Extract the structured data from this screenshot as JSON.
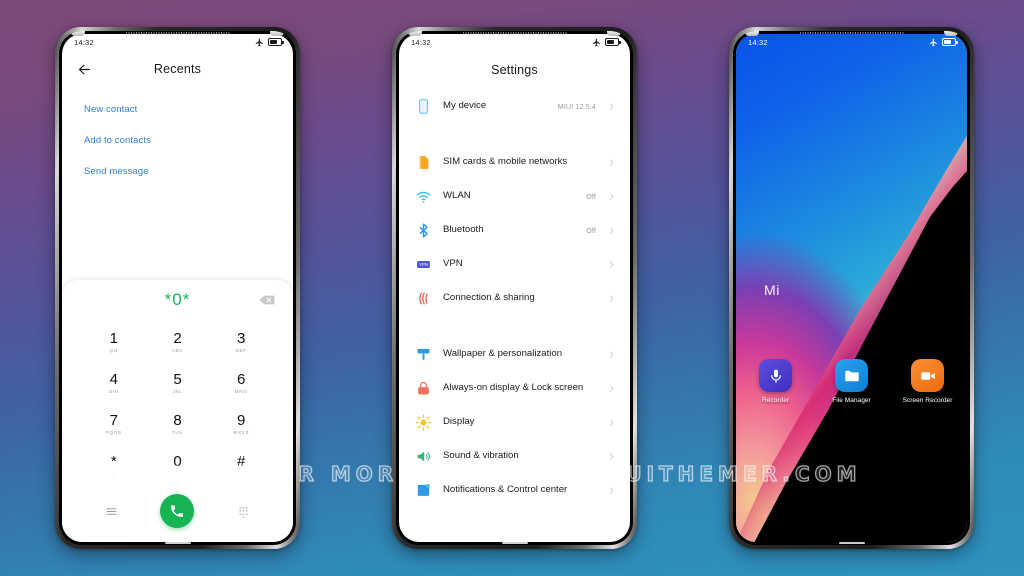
{
  "watermark": "VISIT FOR MORE THEMES - MIUITHEMER.COM",
  "status_bar": {
    "time": "14:32",
    "airplane_icon": "airplane-mode-icon",
    "battery_icon": "battery-icon"
  },
  "phone1": {
    "name": "dialer-phone",
    "header": {
      "back_icon": "back-arrow-icon",
      "title": "Recents"
    },
    "links": [
      {
        "label": "New contact"
      },
      {
        "label": "Add to contacts"
      },
      {
        "label": "Send message"
      }
    ],
    "dialer": {
      "number": "*0*",
      "backspace_icon": "backspace-icon",
      "keys": [
        {
          "digit": "1",
          "sub": "QD"
        },
        {
          "digit": "2",
          "sub": "ABC"
        },
        {
          "digit": "3",
          "sub": "DEF"
        },
        {
          "digit": "4",
          "sub": "GHI"
        },
        {
          "digit": "5",
          "sub": "JKL"
        },
        {
          "digit": "6",
          "sub": "MNO"
        },
        {
          "digit": "7",
          "sub": "PQRS"
        },
        {
          "digit": "8",
          "sub": "TUV"
        },
        {
          "digit": "9",
          "sub": "WXYZ"
        },
        {
          "digit": "*",
          "sub": ","
        },
        {
          "digit": "0",
          "sub": ""
        },
        {
          "digit": "#",
          "sub": ""
        }
      ],
      "menu_icon": "menu-icon",
      "call_icon": "call-icon",
      "keypad_icon": "keypad-grid-icon",
      "call_color": "#18b454",
      "number_color": "#19b558"
    }
  },
  "phone2": {
    "name": "settings-phone",
    "title": "Settings",
    "groups": [
      {
        "rows": [
          {
            "icon": "device-icon",
            "label": "My device",
            "value": "MIUI 12.5.4",
            "chevron": "chevron-right-icon"
          }
        ]
      },
      {
        "rows": [
          {
            "icon": "sim-card-icon",
            "label": "SIM cards & mobile networks",
            "value": "",
            "chevron": "chevron-right-icon"
          },
          {
            "icon": "wifi-icon",
            "label": "WLAN",
            "value": "Off",
            "chevron": "chevron-right-icon"
          },
          {
            "icon": "bluetooth-icon",
            "label": "Bluetooth",
            "value": "Off",
            "chevron": "chevron-right-icon"
          },
          {
            "icon": "vpn-icon",
            "label": "VPN",
            "value": "",
            "chevron": "chevron-right-icon"
          },
          {
            "icon": "connection-sharing-icon",
            "label": "Connection & sharing",
            "value": "",
            "chevron": "chevron-right-icon"
          }
        ]
      },
      {
        "rows": [
          {
            "icon": "wallpaper-icon",
            "label": "Wallpaper & personalization",
            "value": "",
            "chevron": "chevron-right-icon"
          },
          {
            "icon": "lock-screen-icon",
            "label": "Always-on display & Lock screen",
            "value": "",
            "chevron": "chevron-right-icon"
          },
          {
            "icon": "display-icon",
            "label": "Display",
            "value": "",
            "chevron": "chevron-right-icon"
          },
          {
            "icon": "sound-icon",
            "label": "Sound & vibration",
            "value": "",
            "chevron": "chevron-right-icon"
          },
          {
            "icon": "notifications-icon",
            "label": "Notifications & Control center",
            "value": "",
            "chevron": "chevron-right-icon"
          }
        ]
      }
    ]
  },
  "phone3": {
    "name": "home-screen-phone",
    "wallpaper_label": "Mi",
    "apps": [
      {
        "icon": "microphone-icon",
        "label": "Recorder",
        "color": "#4b3fd4"
      },
      {
        "icon": "folder-icon",
        "label": "File Manager",
        "color": "#1a8fe3"
      },
      {
        "icon": "video-camera-icon",
        "label": "Screen Recorder",
        "color": "#f07818"
      }
    ]
  }
}
